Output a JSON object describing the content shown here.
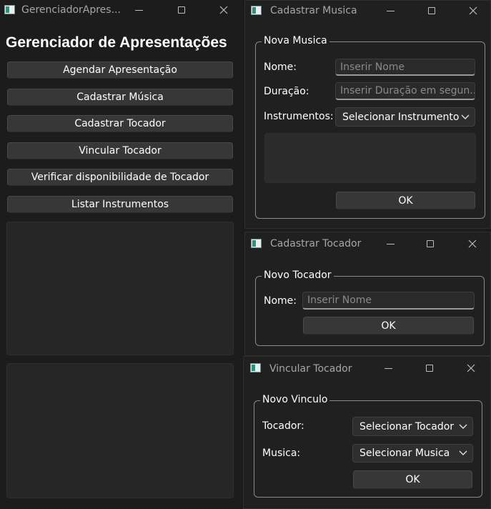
{
  "main_window": {
    "title": "GerenciadorApres...",
    "heading": "Gerenciador de Apresentações",
    "buttons": [
      "Agendar Apresentação",
      "Cadastrar Música",
      "Cadastrar Tocador",
      "Vincular Tocador",
      "Verificar disponibilidade de Tocador",
      "Listar Instrumentos"
    ]
  },
  "musica_window": {
    "title": "Cadastrar Musica",
    "group_title": "Nova Musica",
    "nome_label": "Nome:",
    "nome_placeholder": "Inserir Nome",
    "duracao_label": "Duração:",
    "duracao_placeholder": "Inserir Duração em segun...",
    "instrumentos_label": "Instrumentos:",
    "instrumentos_selected": "Selecionar Instrumento",
    "ok_label": "OK"
  },
  "tocador_window": {
    "title": "Cadastrar Tocador",
    "group_title": "Novo Tocador",
    "nome_label": "Nome:",
    "nome_placeholder": "Inserir Nome",
    "ok_label": "OK"
  },
  "vincular_window": {
    "title": "Vincular Tocador",
    "group_title": "Novo Vinculo",
    "tocador_label": "Tocador:",
    "tocador_selected": "Selecionar Tocador",
    "musica_label": "Musica:",
    "musica_selected": "Selecionar Musica",
    "ok_label": "OK"
  }
}
